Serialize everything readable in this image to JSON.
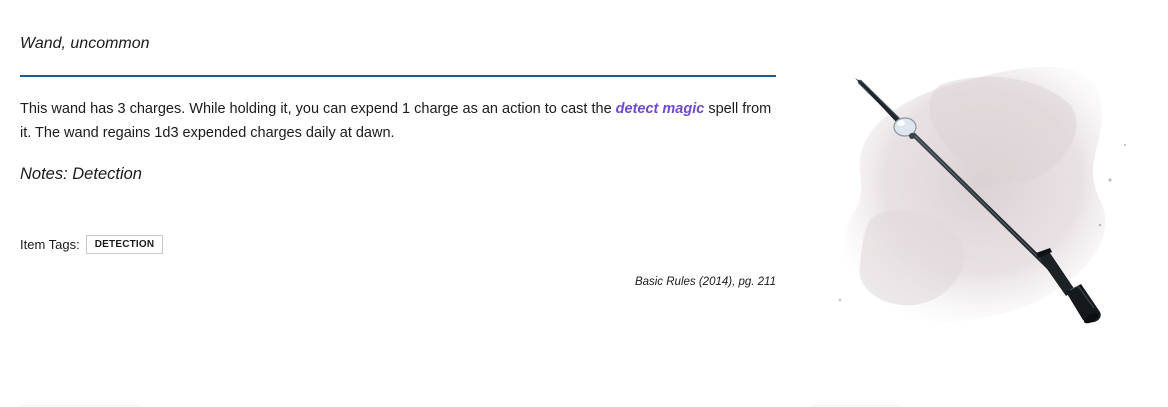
{
  "item": {
    "subtitle": "Wand, uncommon",
    "description_part1": "This wand has 3 charges. While holding it, you can expend 1 charge as an action to cast the ",
    "spell_link": "detect magic",
    "description_part2": " spell from it. The wand regains 1d3 expended charges daily at dawn.",
    "notes": "Notes: Detection",
    "tags_label": "Item Tags:",
    "tags": [
      "DETECTION"
    ],
    "source": "Basic Rules (2014), pg. 211"
  },
  "colors": {
    "divider": "#1d5a96",
    "spell_link": "#6f4ad1",
    "text": "#1b1b1b"
  },
  "illustration": {
    "icon": "wand-illustration"
  }
}
